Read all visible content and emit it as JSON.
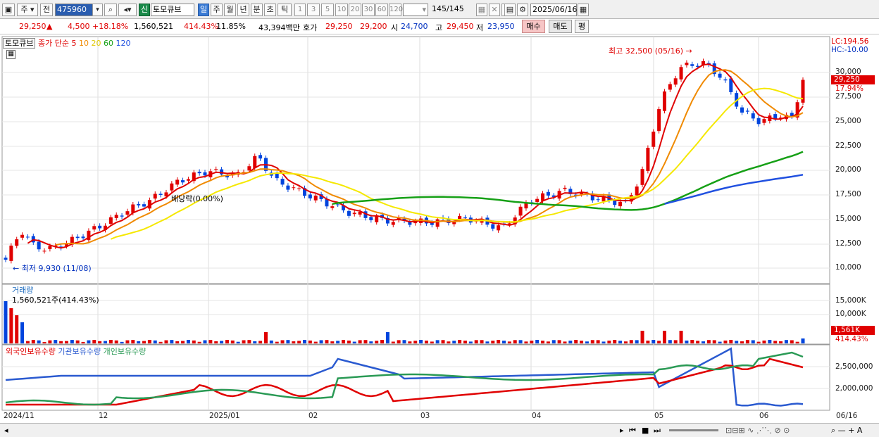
{
  "toolbar": {
    "market": "주",
    "prev_btn": "전",
    "code": "475960",
    "badge": "신",
    "name": "토모큐브",
    "periods": [
      "일",
      "주",
      "월",
      "년",
      "분",
      "초",
      "틱"
    ],
    "minutes": [
      "1",
      "3",
      "5",
      "10",
      "20",
      "30",
      "60",
      "120"
    ],
    "count": "145",
    "total": "/145",
    "date": "2025/06/16"
  },
  "quote": {
    "price": "29,250",
    "arrow": "▲",
    "change": "4,500",
    "pct": "+18.18%",
    "volume": "1,560,521",
    "vol_ratio": "414.43%",
    "turnover": "11.85%",
    "amount": "43,394백만",
    "bid_label": "호가",
    "ask": "29,250",
    "bid": "29,200",
    "open_label": "시",
    "open": "24,700",
    "high_label": "고",
    "high": "29,450",
    "low_label": "저",
    "low": "23,950",
    "buy": "매수",
    "sell": "매도",
    "avg": "평"
  },
  "legend": {
    "name": "토모큐브",
    "series_label": "종가 단순",
    "ma": [
      "5",
      "10",
      "20",
      "60",
      "120"
    ]
  },
  "annotations": {
    "max": "최고 32,500 (05/16)",
    "min": "최저 9,930 (11/08)",
    "dividend": "배당락(0.00%)"
  },
  "price_axis": {
    "lc": "LC:194.56",
    "hc": "HC:-10.00",
    "ticks": [
      "30,000",
      "27,500",
      "25,000",
      "22,500",
      "20,000",
      "17,500",
      "15,000",
      "12,500",
      "10,000"
    ],
    "current": "29,250",
    "current_pct": "17.94%"
  },
  "volume_panel": {
    "title": "거래량",
    "info": "1,560,521주(414.43%)",
    "ticks": [
      "15,000K",
      "10,000K"
    ],
    "current": "1,561K",
    "current_pct": "414.43%"
  },
  "holdings_panel": {
    "labels": [
      "외국인보유수량",
      "기관보유수량",
      "개인보유수량"
    ],
    "ticks": [
      "2,500,000",
      "2,000,000"
    ]
  },
  "time_axis": [
    "2024/11",
    "12",
    "2025/01",
    "02",
    "03",
    "04",
    "05",
    "06",
    "06/16"
  ],
  "colors": {
    "up": "#e00000",
    "down": "#0044dd",
    "ma5": "#e00000",
    "ma10": "#f08a00",
    "ma20": "#f5e800",
    "ma60": "#16a016",
    "ma120": "#2050e0"
  }
}
